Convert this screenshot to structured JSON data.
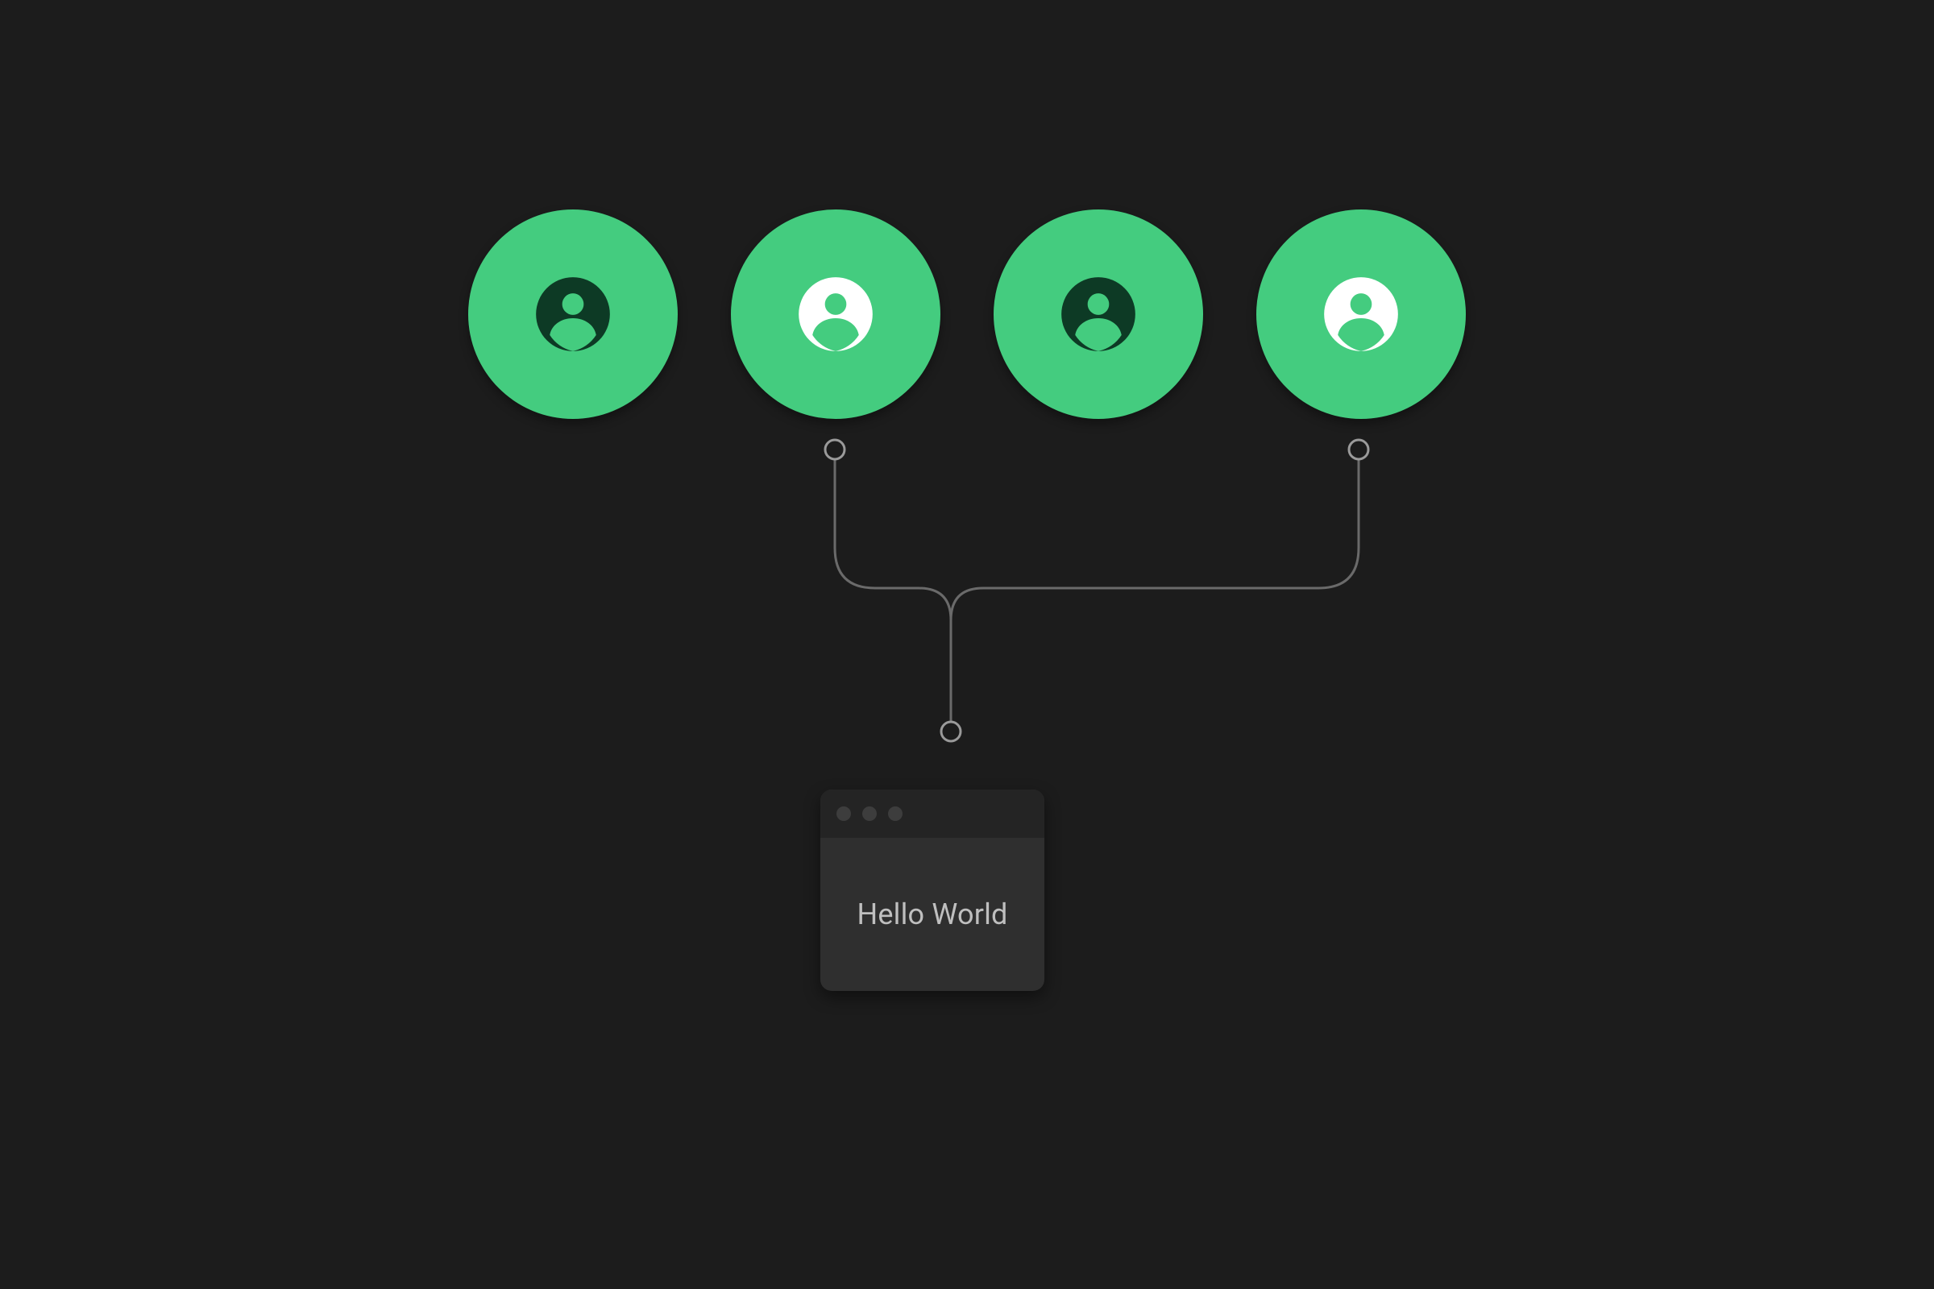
{
  "colors": {
    "avatar_bg": "#44cc7f",
    "avatar_icon_dark": "#0d3a25",
    "avatar_icon_light": "#ffffff",
    "connector": "#6a6a6a",
    "canvas_bg": "#1c1c1c"
  },
  "avatars": [
    {
      "icon": "person-icon",
      "variant": "dark",
      "connected": false
    },
    {
      "icon": "person-icon",
      "variant": "light",
      "connected": true
    },
    {
      "icon": "person-icon",
      "variant": "dark",
      "connected": false
    },
    {
      "icon": "person-icon",
      "variant": "light",
      "connected": true
    }
  ],
  "window": {
    "content_text": "Hello World"
  }
}
